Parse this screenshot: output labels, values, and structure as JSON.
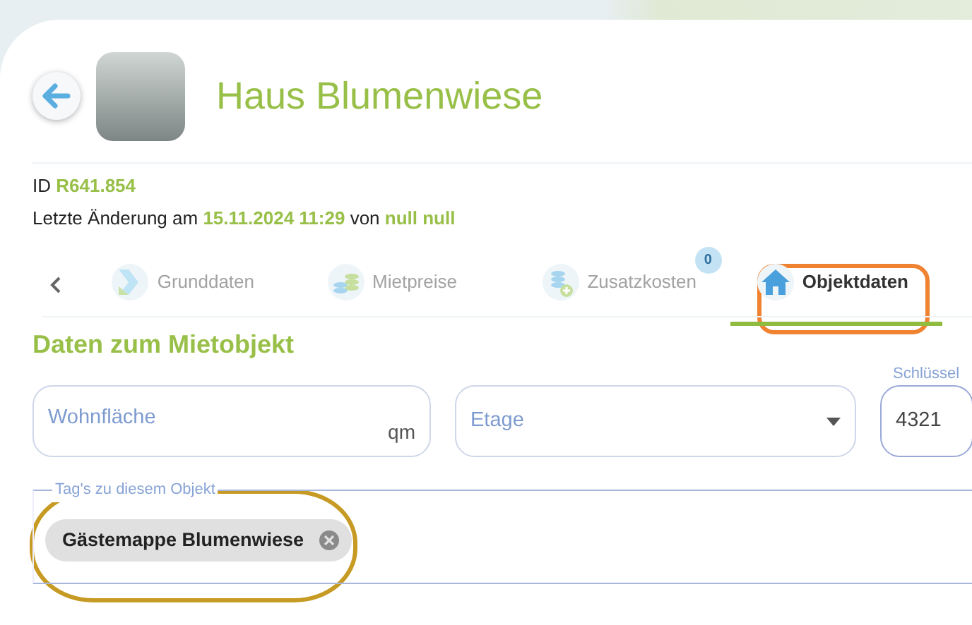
{
  "header": {
    "title": "Haus Blumenwiese"
  },
  "meta": [
    "ID **R641.854**",
    "Letzte Änderung am **15.11.2024 11:29** von **null null**"
  ],
  "tabs": [
    {
      "label": "Grunddaten",
      "kind": "chevron-mark",
      "selected": false
    },
    {
      "label": "Mietpreise",
      "kind": "coins",
      "selected": false
    },
    {
      "label": "Zusatzkosten",
      "kind": "coins-plus",
      "selected": false,
      "badge": "0"
    },
    {
      "label": "Objektdaten",
      "kind": "house",
      "selected": true
    }
  ],
  "section_title": "Daten zum Mietobjekt",
  "fields": [
    {
      "kind": "unit",
      "placeholder": "Wohnfläche",
      "unit": "qm"
    },
    {
      "kind": "select",
      "placeholder": "Etage"
    },
    {
      "kind": "outlined",
      "label": "Schlüssel",
      "value": "4321"
    }
  ],
  "tags": {
    "label": "Tag's zu diesem Objekt",
    "chips": [
      {
        "text": "Gästemappe Blumenwiese"
      }
    ]
  }
}
